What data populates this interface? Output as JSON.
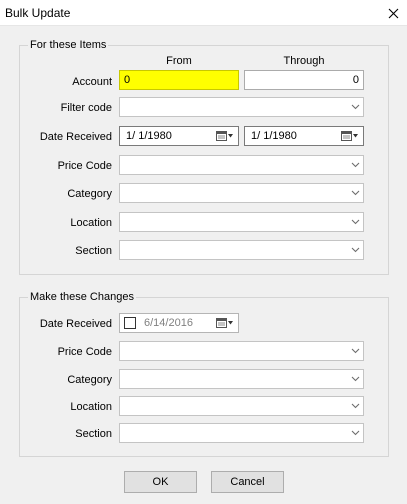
{
  "window": {
    "title": "Bulk Update",
    "close_glyph": "✕"
  },
  "items_group": {
    "legend": "For these Items",
    "from_header": "From",
    "through_header": "Through",
    "account_label": "Account",
    "account_from": "0",
    "account_through": "0",
    "filter_code_label": "Filter code",
    "date_received_label": "Date Received",
    "date_from": "1/  1/1980",
    "date_through": "1/  1/1980",
    "price_code_label": "Price Code",
    "category_label": "Category",
    "location_label": "Location",
    "section_label": "Section"
  },
  "changes_group": {
    "legend": "Make these Changes",
    "date_received_label": "Date Received",
    "date_value": "6/14/2016",
    "price_code_label": "Price Code",
    "category_label": "Category",
    "location_label": "Location",
    "section_label": "Section"
  },
  "buttons": {
    "ok": "OK",
    "cancel": "Cancel"
  },
  "colors": {
    "highlight": "#ffff00",
    "background": "#f0f0f0",
    "button": "#e1e1e1"
  },
  "icons": [
    "close-icon",
    "chevron-down-icon",
    "calendar-icon",
    "checkbox-icon"
  ]
}
